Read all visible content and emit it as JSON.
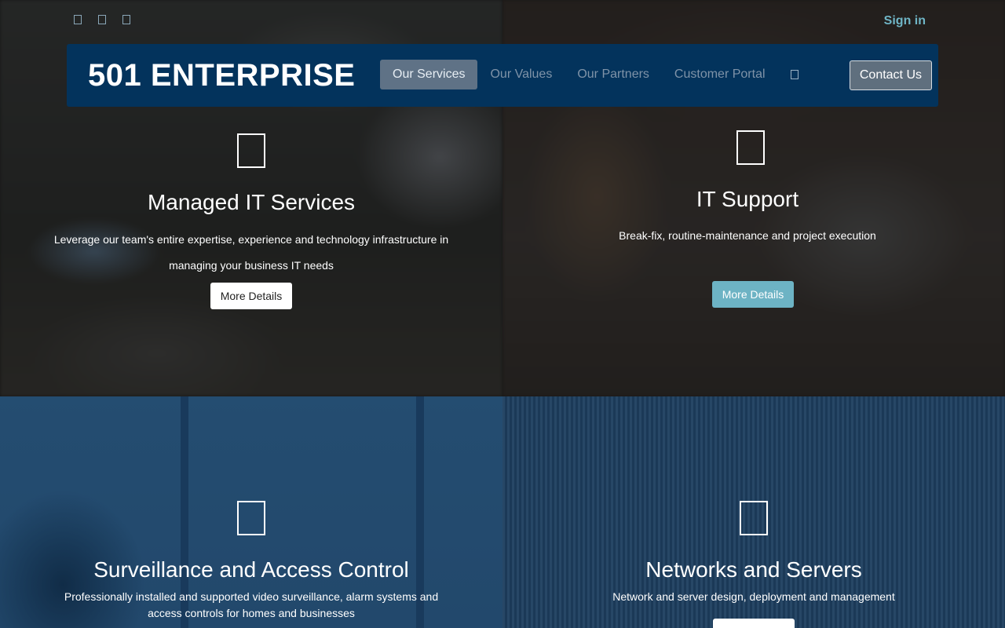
{
  "top": {
    "social_icons": [
      "facebook-icon",
      "twitter-icon",
      "linkedin-icon"
    ],
    "sign_in": "Sign in"
  },
  "navbar": {
    "brand": "501 ENTERPRISE",
    "items": [
      {
        "label": "Our Services",
        "active": true
      },
      {
        "label": "Our Values",
        "active": false
      },
      {
        "label": "Our Partners",
        "active": false
      },
      {
        "label": "Customer Portal",
        "active": false
      }
    ],
    "search_icon": "search-icon",
    "contact": "Contact Us"
  },
  "services": [
    {
      "title": "Managed IT Services",
      "description": "Leverage our team's entire expertise, experience and technology infrastructure in managing your business IT needs",
      "button": "More Details"
    },
    {
      "title": "IT Support",
      "description": "Break-fix, routine-maintenance and project execution",
      "button": "More Details"
    },
    {
      "title": "Surveillance and Access Control",
      "description": "Professionally installed and supported video surveillance, alarm systems and access controls for homes and businesses"
    },
    {
      "title": "Networks and Servers",
      "description": "Network and server design, deployment and management"
    }
  ],
  "colors": {
    "navbar": "#03335c",
    "accent": "#6fb5c6",
    "teal_button": "#6db3c4"
  }
}
